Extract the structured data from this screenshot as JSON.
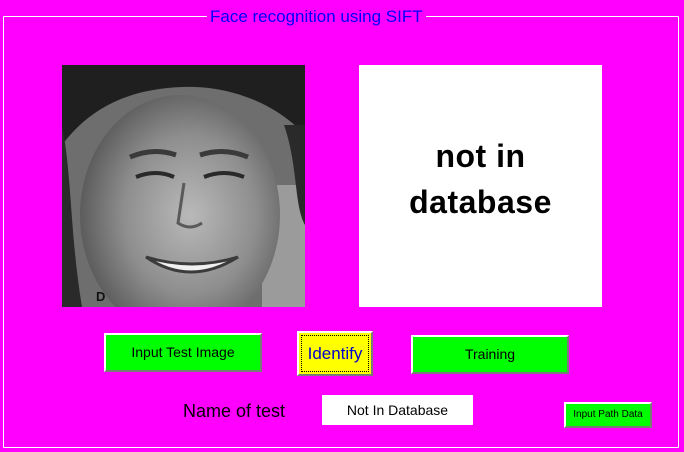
{
  "window": {
    "group_title": "Face recognition using SIFT"
  },
  "panels": {
    "input_face_letter": "D",
    "result_text": "not in\ndatabase"
  },
  "buttons": {
    "input_test_image": "Input Test Image",
    "identify": "Identify",
    "training": "Training",
    "input_path_data": "Input Path Data"
  },
  "name_row": {
    "label": "Name of test",
    "value": "Not In Database"
  },
  "colors": {
    "background": "#ff00ff",
    "title": "#0000ff",
    "green_button": "#00ff00",
    "identify_button": "#ffff00",
    "identify_text": "#0000cc"
  }
}
